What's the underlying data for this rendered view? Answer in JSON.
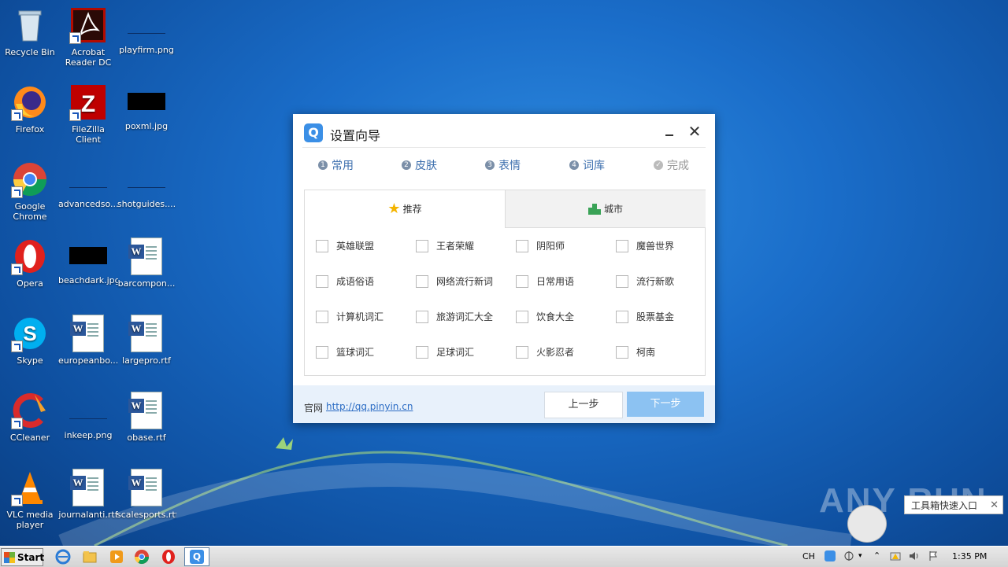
{
  "desktop": {
    "icons": [
      {
        "label": "Recycle Bin"
      },
      {
        "label": "Acrobat Reader DC"
      },
      {
        "label": "playfirm.png"
      },
      {
        "label": "Firefox"
      },
      {
        "label": "FileZilla Client"
      },
      {
        "label": "poxml.jpg"
      },
      {
        "label": "Google Chrome"
      },
      {
        "label": "advancedso..."
      },
      {
        "label": "shotguides...."
      },
      {
        "label": "Opera"
      },
      {
        "label": "beachdark.jpg"
      },
      {
        "label": "barcompon..."
      },
      {
        "label": "Skype"
      },
      {
        "label": "europeanbo..."
      },
      {
        "label": "largepro.rtf"
      },
      {
        "label": "CCleaner"
      },
      {
        "label": "inkeep.png"
      },
      {
        "label": "obase.rtf"
      },
      {
        "label": "VLC media player"
      },
      {
        "label": "journalanti.rtf"
      },
      {
        "label": "scalesports.rtf"
      }
    ]
  },
  "dialog": {
    "logo": "Q",
    "title": "设置向导",
    "steps": [
      {
        "num": "1",
        "label": "常用"
      },
      {
        "num": "2",
        "label": "皮肤"
      },
      {
        "num": "3",
        "label": "表情"
      },
      {
        "num": "4",
        "label": "词库"
      },
      {
        "num": "✓",
        "label": "完成"
      }
    ],
    "tabs": [
      {
        "label": "推荐"
      },
      {
        "label": "城市"
      }
    ],
    "options": [
      "英雄联盟",
      "王者荣耀",
      "阴阳师",
      "魔兽世界",
      "成语俗语",
      "网络流行新词",
      "日常用语",
      "流行新歌",
      "计算机词汇",
      "旅游词汇大全",
      "饮食大全",
      "股票基金",
      "篮球词汇",
      "足球词汇",
      "火影忍者",
      "柯南"
    ],
    "footer": {
      "label": "官网",
      "link": "http://qq.pinyin.cn",
      "prev": "上一步",
      "next": "下一步"
    }
  },
  "taskbar": {
    "start": "Start",
    "lang": "CH",
    "time": "1:35 PM"
  },
  "tooltip": {
    "text": "工具箱快速入口",
    "close": "✕"
  },
  "watermark": "ANY RUN",
  "colors": {
    "accent": "#3b8fe6",
    "next_button": "#8cc2f2",
    "footer_bg": "#e8f1fb",
    "link": "#2b6cc4"
  }
}
